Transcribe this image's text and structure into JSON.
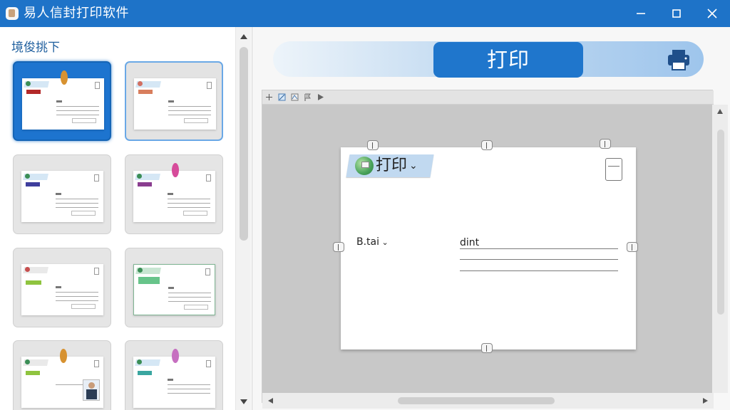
{
  "window": {
    "title": "易人信封打印软件",
    "accent": "#1e73c8"
  },
  "window_controls": {
    "minimize": "minimize-icon",
    "maximize": "maximize-icon",
    "close": "close-icon"
  },
  "sidebar": {
    "title": "境俊挑下",
    "templates": [
      {
        "state": "selected",
        "pin": "#d79231"
      },
      {
        "state": "hover",
        "pin": ""
      },
      {
        "state": "normal",
        "pin": ""
      },
      {
        "state": "normal",
        "pin": "#d64b9a"
      },
      {
        "state": "normal",
        "pin": ""
      },
      {
        "state": "normal",
        "pin": ""
      },
      {
        "state": "normal",
        "pin": "#d79231"
      },
      {
        "state": "normal",
        "pin": "#c66fc0"
      }
    ]
  },
  "main": {
    "print_button": "打印",
    "printer_icon": "printer-icon"
  },
  "preview": {
    "envelope": {
      "print_label": "打印",
      "sender_label": "B.tai",
      "recipient_label": "dint"
    }
  }
}
